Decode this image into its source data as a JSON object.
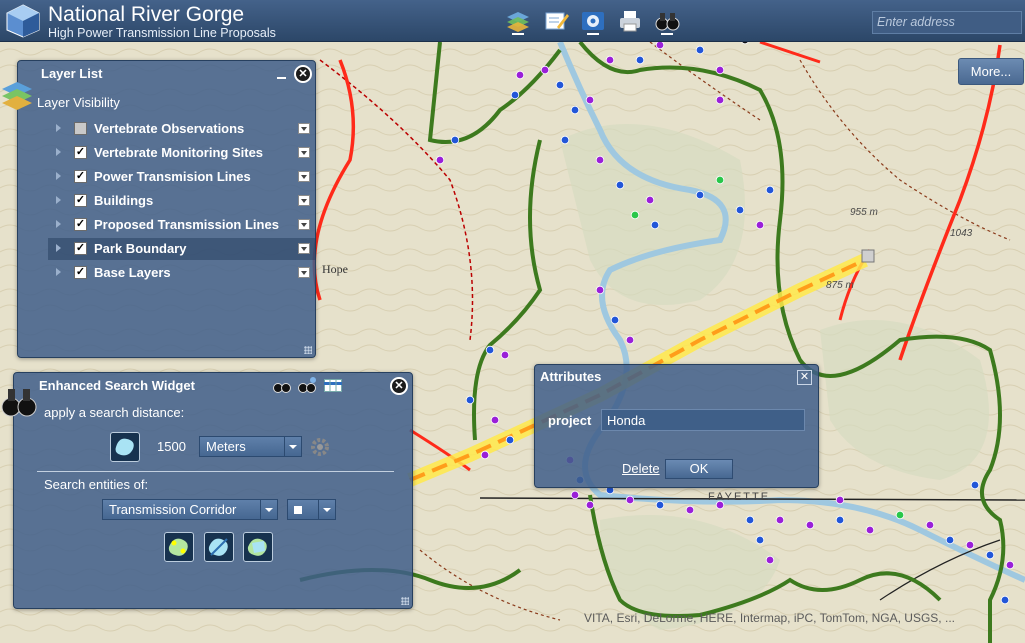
{
  "header": {
    "title": "National River Gorge",
    "subtitle": "High Power Transmission Line Proposals",
    "address_placeholder": "Enter address",
    "toolbar_icons": [
      "layers-icon",
      "edit-icon",
      "settings-icon",
      "print-icon",
      "binoculars-icon"
    ]
  },
  "more_button": "More...",
  "layer_list": {
    "title": "Layer List",
    "section_label": "Layer Visibility",
    "layers": [
      {
        "label": "Vertebrate Observations",
        "checked": false
      },
      {
        "label": "Vertebrate Monitoring Sites",
        "checked": true
      },
      {
        "label": "Power Transmision Lines",
        "checked": true
      },
      {
        "label": "Buildings",
        "checked": true
      },
      {
        "label": "Proposed Transmission Lines",
        "checked": true
      },
      {
        "label": "Park Boundary",
        "checked": true,
        "selected": true
      },
      {
        "label": "Base Layers",
        "checked": true
      }
    ]
  },
  "search_widget": {
    "title": "Enhanced Search Widget",
    "distance_label": "apply a search distance:",
    "distance_value": "1500",
    "unit": "Meters",
    "entities_label": "Search entities of:",
    "entity": "Transmission Corridor"
  },
  "attributes": {
    "title": "Attributes",
    "field_label": "project",
    "field_value": "Honda",
    "delete_label": "Delete",
    "ok_label": "OK"
  },
  "map_labels": {
    "elev1": "955 m",
    "elev2": "875 m",
    "elev3": "1043",
    "place_hope": "Hope",
    "place_fayette": "FAYETTE",
    "attribution": "VITA, Esri, DeLorme, HERE, Intermap, iPC, TomTom, NGA, USGS, ..."
  },
  "colors": {
    "header": "#2c4768",
    "panel": "#405e89",
    "park_boundary": "#3d7a1e",
    "power_line": "#ff2a1a",
    "proposed_line": "#ffd200",
    "river": "#9fc8e0"
  }
}
